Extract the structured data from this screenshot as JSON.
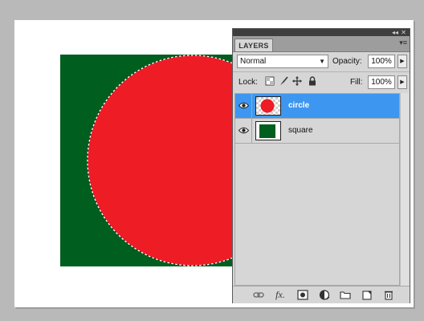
{
  "colors": {
    "canvas_bg": "#ffffff",
    "square": "#005f1e",
    "circle": "#ee1c25",
    "selection_highlight": "#3d97f0"
  },
  "panel": {
    "tab_label": "LAYERS",
    "blend_mode": "Normal",
    "opacity_label": "Opacity:",
    "opacity_value": "100%",
    "lock_label": "Lock:",
    "fill_label": "Fill:",
    "fill_value": "100%",
    "icons": {
      "collapse": "double-chevron-icon",
      "close": "close-icon",
      "menu": "panel-menu-icon",
      "dropdown": "chevron-down-icon",
      "stepper": "triangle-right-icon"
    }
  },
  "layers": [
    {
      "name": "circle",
      "selected": true,
      "visible": true
    },
    {
      "name": "square",
      "selected": false,
      "visible": true
    }
  ],
  "bottom_bar": {
    "link_icon": "link-icon",
    "fx_label": "fx.",
    "mask_icon": "mask-icon",
    "adjustment_icon": "adjustment-icon",
    "group_icon": "folder-icon",
    "new_layer_icon": "new-layer-icon",
    "trash_icon": "trash-icon"
  }
}
